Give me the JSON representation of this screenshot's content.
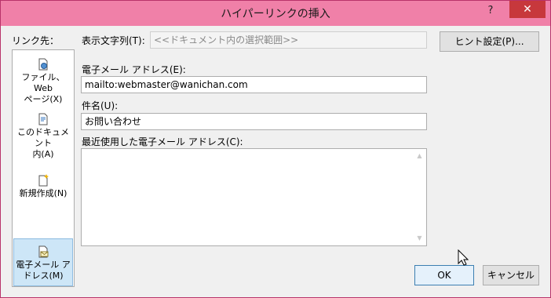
{
  "window": {
    "title": "ハイパーリンクの挿入",
    "help_glyph": "?",
    "close_glyph": "✕"
  },
  "link_to": {
    "label": "リンク先：",
    "items": [
      {
        "label_line1": "ファイル、Web",
        "label_line2": "ページ(X)",
        "icon": "web-page-icon"
      },
      {
        "label_line1": "このドキュメント",
        "label_line2": "内(A)",
        "icon": "document-icon"
      },
      {
        "label_line1": "新規作成(N)",
        "label_line2": "",
        "icon": "new-document-icon"
      },
      {
        "label_line1": "電子メール ア",
        "label_line2": "ドレス(M)",
        "icon": "email-icon",
        "selected": true
      }
    ]
  },
  "display_text": {
    "label": "表示文字列(T):",
    "value": "<<ドキュメント内の選択範囲>>"
  },
  "screentip_button": "ヒント設定(P)...",
  "email_address": {
    "label": "電子メール アドレス(E):",
    "value": "mailto:webmaster@wanichan.com"
  },
  "subject": {
    "label": "件名(U):",
    "value": "お問い合わせ"
  },
  "recent_addresses": {
    "label": "最近使用した電子メール アドレス(C):"
  },
  "buttons": {
    "ok": "OK",
    "cancel": "キャンセル"
  },
  "colors": {
    "titlebar": "#f080a8",
    "close": "#c7383c",
    "selected_item": "#cde6f7"
  }
}
